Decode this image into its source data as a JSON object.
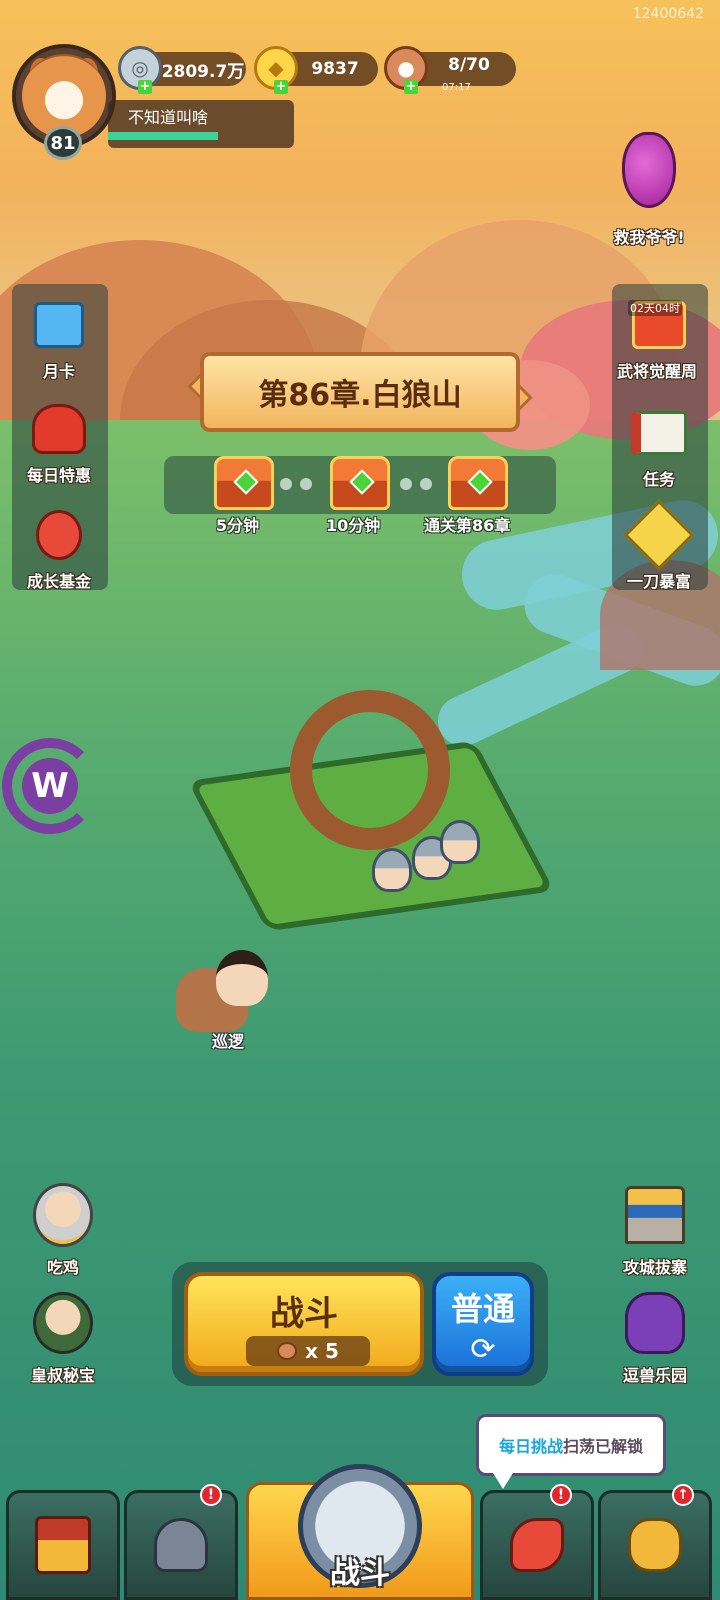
{
  "server_id": "12400642",
  "player": {
    "name": "不知道叫啥",
    "level": "81"
  },
  "resources": {
    "silver": "2809.7万",
    "gold": "9837",
    "stamina": "8/70",
    "stamina_timer": "07:17"
  },
  "top_right": {
    "rescue_label": "救我爷爷!"
  },
  "left_menu": [
    {
      "label": "月卡"
    },
    {
      "label": "每日特惠"
    },
    {
      "label": "成长基金"
    }
  ],
  "right_menu": [
    {
      "label": "武将觉醒周",
      "badge": "02天04时"
    },
    {
      "label": "任务"
    },
    {
      "label": "一刀暴富"
    }
  ],
  "chapter": {
    "title": "第86章.白狼山",
    "rewards": [
      {
        "label": "5分钟"
      },
      {
        "label": "10分钟"
      },
      {
        "label": "通关第86章"
      }
    ]
  },
  "map": {
    "patrol_label": "巡逻"
  },
  "bottom_left": [
    {
      "label": "吃鸡"
    },
    {
      "label": "皇叔秘宝"
    }
  ],
  "bottom_right": [
    {
      "label": "攻城拔寨"
    },
    {
      "label": "逗兽乐园"
    }
  ],
  "actions": {
    "fight_label": "战斗",
    "fight_cost": "x 5",
    "mode_label": "普通"
  },
  "tooltip": {
    "highlight": "每日挑战",
    "rest": "扫荡已解锁"
  },
  "nav": {
    "center_label": "战斗"
  }
}
